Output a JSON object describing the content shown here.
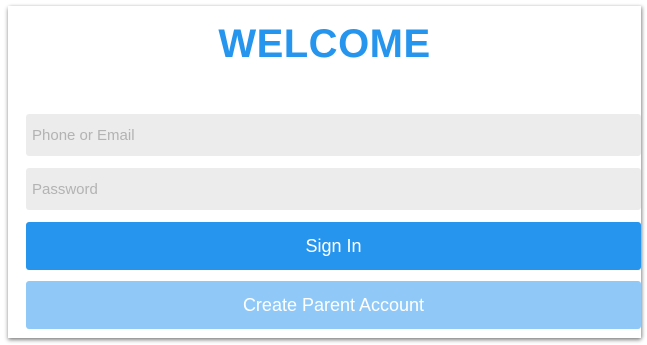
{
  "login": {
    "title": "WELCOME",
    "phone_placeholder": "Phone or Email",
    "password_placeholder": "Password",
    "sign_in_label": "Sign In",
    "create_account_label": "Create Parent Account"
  },
  "colors": {
    "primary": "#2595ee",
    "primary_light": "#90c9f7",
    "field_bg": "#ececec",
    "placeholder": "#b3b3b3"
  }
}
